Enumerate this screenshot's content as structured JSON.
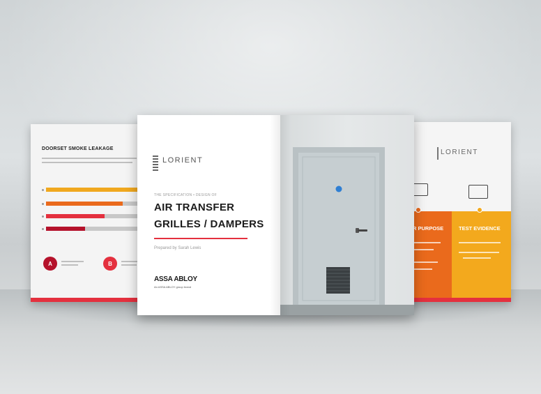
{
  "left_brochure": {
    "title": "DOORSET SMOKE LEAKAGE",
    "badges": [
      {
        "letter": "A",
        "color": "#b5122b"
      },
      {
        "letter": "B",
        "color": "#e4303e"
      }
    ],
    "bar_colors": [
      "#f0a81f",
      "#ea6a1c",
      "#e4303e",
      "#b5122b"
    ]
  },
  "center_brochure": {
    "logo": "LORIENT",
    "kicker": "THE SPECIFICATION • DESIGN OF",
    "title_line1": "AIR TRANSFER",
    "title_line2": "GRILLES / DAMPERS",
    "byline": "Prepared by Sarah Lewis",
    "brand": "ASSA ABLOY",
    "brand_sub": "An ASSA ABLOY group brand",
    "accent_color": "#e4303e"
  },
  "right_brochure": {
    "logo": "LORIENT",
    "panel_left_heading": "R PURPOSE",
    "panel_right_heading": "TEST EVIDENCE",
    "colors": {
      "orange": "#ea6a1c",
      "yellow": "#f3a91d"
    }
  }
}
